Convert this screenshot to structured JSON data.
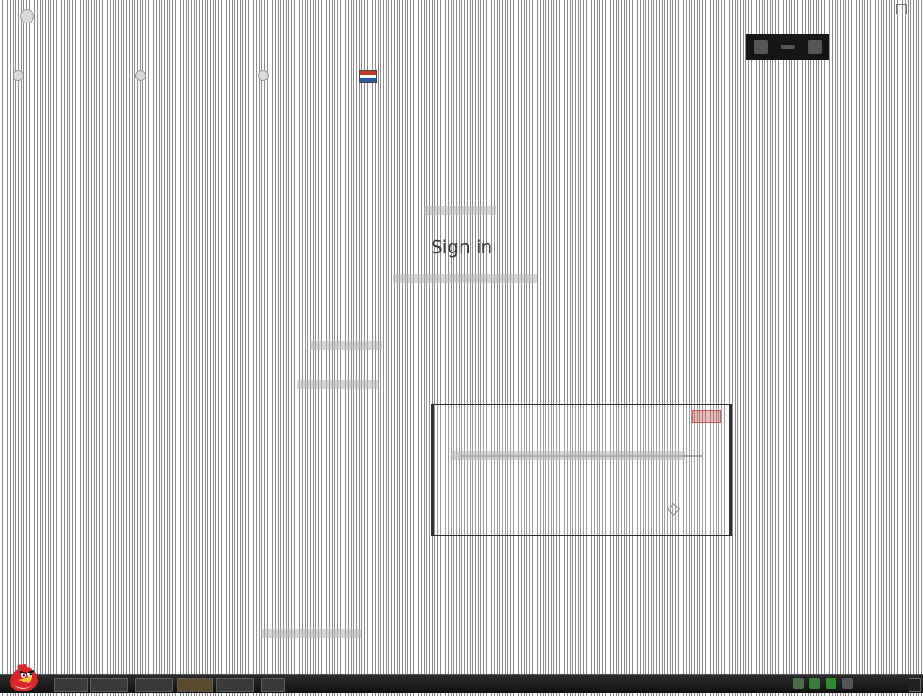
{
  "icons": {
    "top_left": "app-icon",
    "top_right": "window-control-icon",
    "toolbar": [
      "camera-icon",
      "minus-icon",
      "screen-icon"
    ],
    "language": "flag-icon",
    "start": "angry-bird-start-icon"
  },
  "signin": {
    "title": "Sign in"
  },
  "colors": {
    "toolbar_bg": "#151515",
    "taskbar_bg": "#101010",
    "form_border": "#2f2f2f",
    "accent_red": "#c0392b"
  }
}
